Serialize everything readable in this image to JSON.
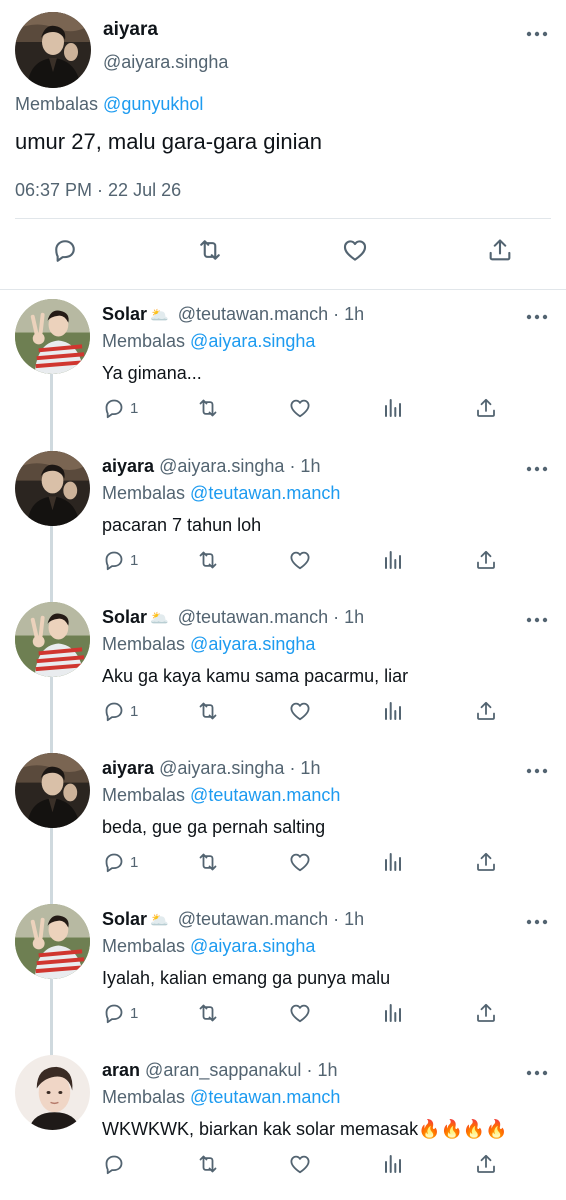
{
  "main_tweet": {
    "name": "aiyara",
    "handle": "@aiyara.singha",
    "reply_prefix": "Membalas",
    "reply_mention": "@gunyukhol",
    "text": "umur 27, malu gara-gara ginian",
    "timestamp": "06:37 PM · 22 Jul 26",
    "actions": [
      "reply-icon",
      "retweet-icon",
      "like-icon",
      "share-icon"
    ]
  },
  "replies": [
    {
      "name": "Solar",
      "emoji": "🌥️",
      "handle": "@teutawan.manch",
      "time": "· 1h",
      "reply_prefix": "Membalas",
      "reply_mention": "@aiyara.singha",
      "text": "Ya gimana...",
      "reply_count": "1",
      "avatar": "solar"
    },
    {
      "name": "aiyara",
      "emoji": "",
      "handle": "@aiyara.singha",
      "time": "· 1h",
      "reply_prefix": "Membalas",
      "reply_mention": "@teutawan.manch",
      "text": "pacaran 7 tahun loh",
      "reply_count": "1",
      "avatar": "aiyara"
    },
    {
      "name": "Solar",
      "emoji": "🌥️",
      "handle": "@teutawan.manch",
      "time": "· 1h",
      "reply_prefix": "Membalas",
      "reply_mention": "@aiyara.singha",
      "text": "Aku ga kaya kamu sama pacarmu, liar",
      "reply_count": "1",
      "avatar": "solar"
    },
    {
      "name": "aiyara",
      "emoji": "",
      "handle": "@aiyara.singha",
      "time": "· 1h",
      "reply_prefix": "Membalas",
      "reply_mention": "@teutawan.manch",
      "text": "beda, gue ga pernah salting",
      "reply_count": "1",
      "avatar": "aiyara"
    },
    {
      "name": "Solar",
      "emoji": "🌥️",
      "handle": "@teutawan.manch",
      "time": "· 1h",
      "reply_prefix": "Membalas",
      "reply_mention": "@aiyara.singha",
      "text": "Iyalah, kalian emang ga punya malu",
      "reply_count": "1",
      "avatar": "solar"
    },
    {
      "name": "aran",
      "emoji": "",
      "handle": "@aran_sappanakul",
      "time": "· 1h",
      "reply_prefix": "Membalas",
      "reply_mention": "@teutawan.manch",
      "text": "WKWKWK, biarkan kak solar memasak🔥🔥🔥🔥",
      "reply_count": "",
      "avatar": "aran"
    }
  ],
  "colors": {
    "accent": "#1d9bf0",
    "secondary_text": "#536471",
    "primary_text": "#0f1419",
    "divider": "#e1e6ea"
  }
}
